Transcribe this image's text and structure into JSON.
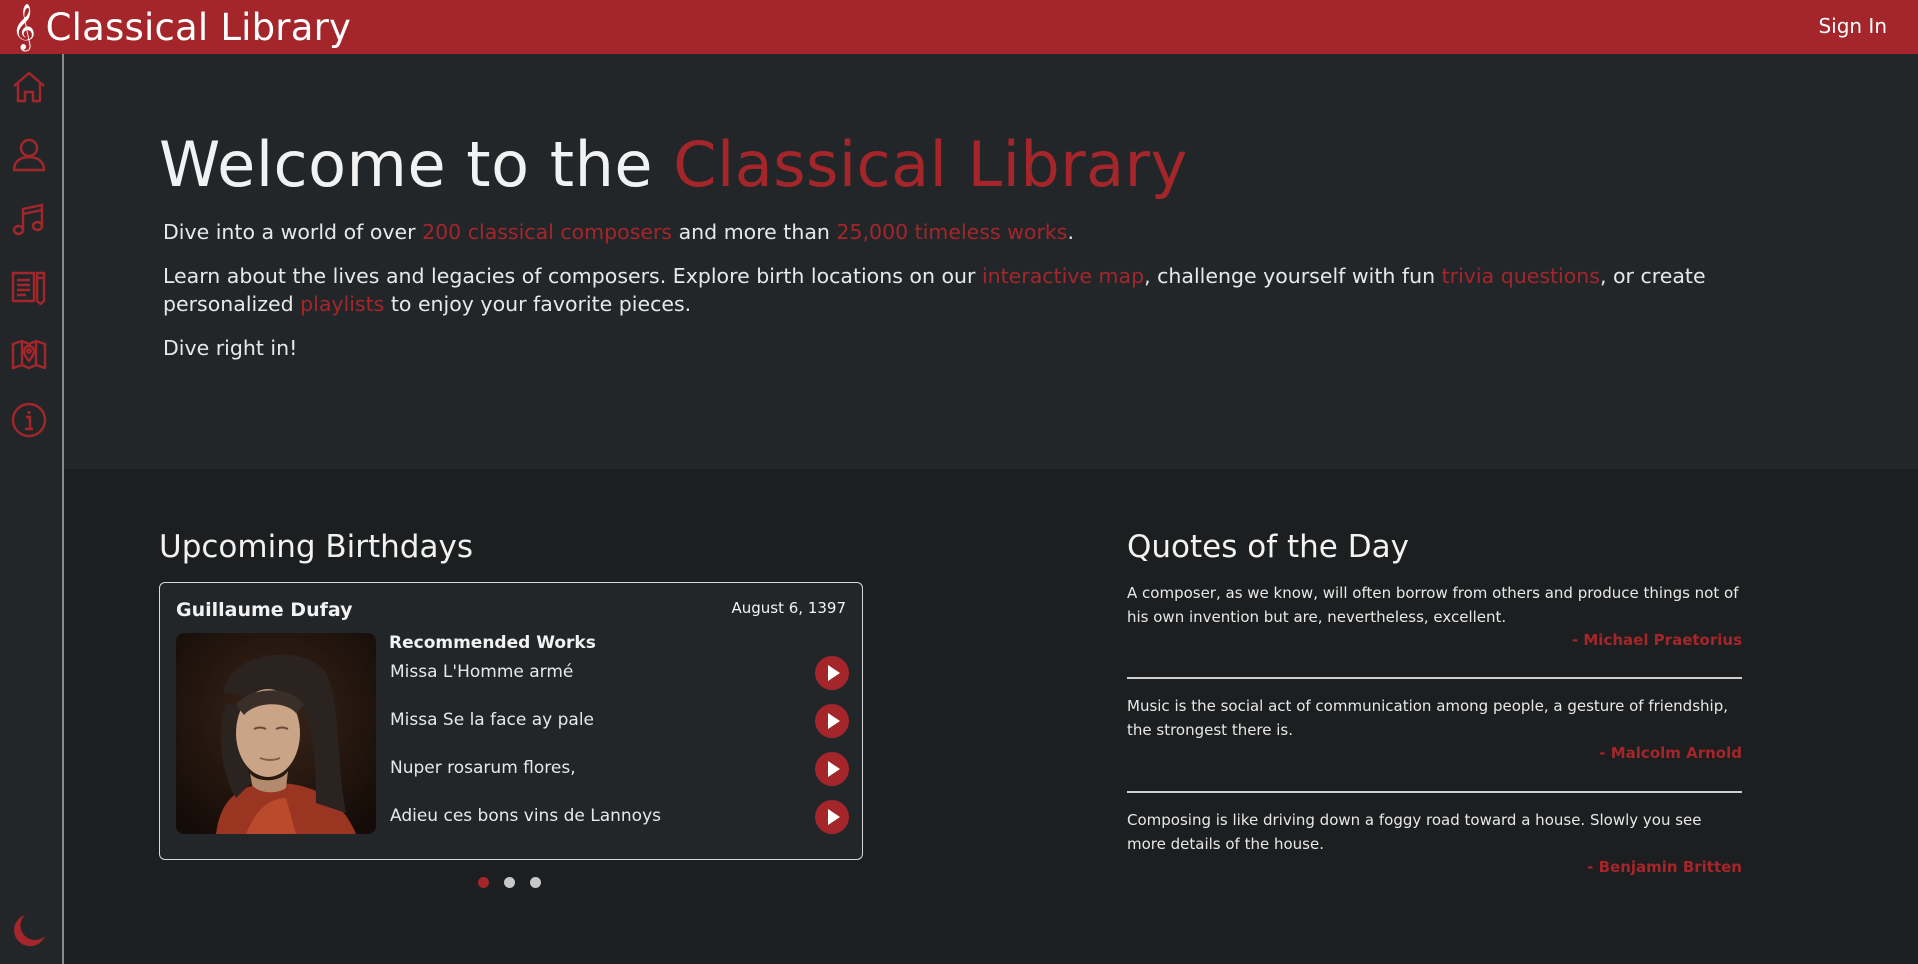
{
  "header": {
    "logo_glyph": "𝄞",
    "title": "Classical Library",
    "sign_in": "Sign In"
  },
  "sidebar": {
    "items": [
      {
        "icon": "home-icon"
      },
      {
        "icon": "user-icon"
      },
      {
        "icon": "music-note-icon"
      },
      {
        "icon": "document-icon"
      },
      {
        "icon": "map-icon"
      },
      {
        "icon": "info-icon"
      }
    ],
    "theme_toggle_icon": "moon-icon"
  },
  "hero": {
    "title_prefix": "Welcome to the ",
    "title_accent": "Classical Library",
    "line1_a": "Dive into a world of over ",
    "line1_link1": "200 classical composers",
    "line1_b": " and more than ",
    "line1_link2": "25,000 timeless works",
    "line1_c": ".",
    "line2_a": "Learn about the lives and legacies of composers. Explore birth locations on our ",
    "line2_link1": "interactive map",
    "line2_b": ", challenge yourself with fun ",
    "line2_link2": "trivia questions",
    "line2_c": ", or create personalized ",
    "line2_link3": "playlists",
    "line2_d": " to enjoy your favorite pieces.",
    "line3": "Dive right in!"
  },
  "birthdays": {
    "title": "Upcoming Birthdays",
    "card": {
      "composer": "Guillaume Dufay",
      "date": "August 6, 1397",
      "recommended_label": "Recommended Works",
      "works": [
        "Missa L'Homme armé",
        "Missa Se la face ay pale",
        "Nuper rosarum flores,",
        "Adieu ces bons vins de Lannoys"
      ]
    },
    "carousel": {
      "count": 3,
      "active": 1
    }
  },
  "quotes": {
    "title": "Quotes of the Day",
    "items": [
      {
        "text": "A composer, as we know, will often borrow from others and produce things not of his own invention but are, nevertheless, excellent.",
        "author": "- Michael Praetorius"
      },
      {
        "text": "Music is the social act of communication among people, a gesture of friendship, the strongest there is.",
        "author": "- Malcolm Arnold"
      },
      {
        "text": "Composing is like driving down a foggy road toward a house. Slowly you see more details of the house.",
        "author": "- Benjamin Britten"
      }
    ]
  },
  "colors": {
    "accent": "#a4262b",
    "background": "#1c1e1f",
    "panel": "#232628"
  }
}
